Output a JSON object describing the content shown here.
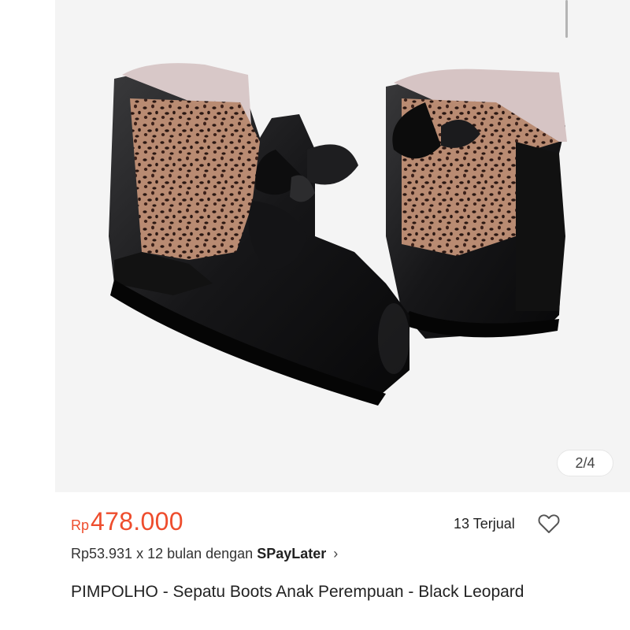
{
  "gallery": {
    "indicator": "2/4",
    "image_alt": "Black ankle boots with leopard print panel and bow"
  },
  "product": {
    "currency": "Rp",
    "price": "478.000",
    "sold_count": "13 Terjual",
    "installment_text": "Rp53.931 x 12 bulan dengan",
    "installment_brand": "SPayLater",
    "installment_chevron": "›",
    "title": "PIMPOLHO - Sepatu Boots Anak Perempuan - Black Leopard"
  },
  "icons": {
    "favorite": "heart-outline-icon",
    "chevron": "chevron-right-icon"
  },
  "colors": {
    "price": "#ee4d2d",
    "background": "#ffffff",
    "image_background": "#f4f4f4"
  }
}
